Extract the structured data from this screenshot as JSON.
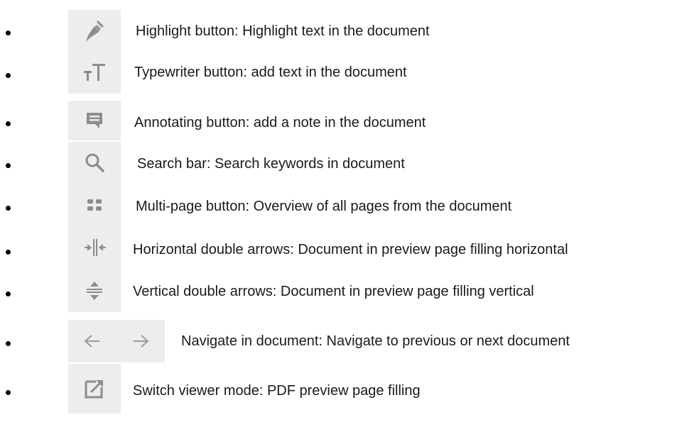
{
  "items": [
    {
      "icon": "highlighter-pen-icon",
      "text": "Highlight button: Highlight text in the document"
    },
    {
      "icon": "typewriter-text-icon",
      "text": "Typewriter button: add text in the document"
    },
    {
      "icon": "note-comment-icon",
      "text": "Annotating button: add a note in the document"
    },
    {
      "icon": "search-magnifier-icon",
      "text": "Search bar: Search keywords in document"
    },
    {
      "icon": "grid-multipage-icon",
      "text": "Multi-page button: Overview of all pages from the document"
    },
    {
      "icon": "horizontal-double-arrows-icon",
      "text": "Horizontal double arrows: Document in preview page filling horizontal"
    },
    {
      "icon": "vertical-double-arrows-icon",
      "text": "Vertical double arrows: Document in preview page filling vertical"
    },
    {
      "icon": "previous-next-arrows-icon",
      "text": "Navigate in document: Navigate to previous or next document"
    },
    {
      "icon": "external-viewer-icon",
      "text": "Switch viewer mode: PDF preview page filling"
    }
  ],
  "colors": {
    "icon_background": "#ededed",
    "icon_gray": "#8c8c8c",
    "text": "#1a1a1a"
  }
}
